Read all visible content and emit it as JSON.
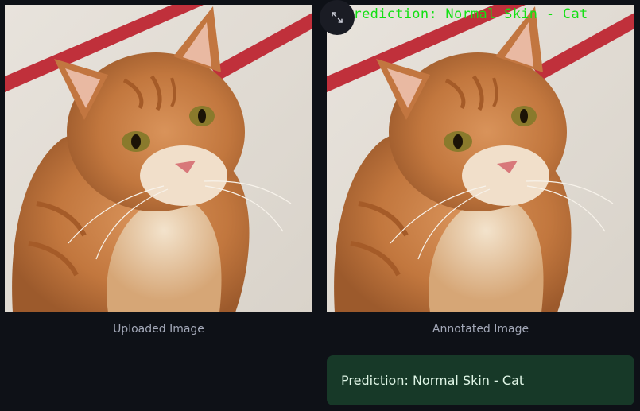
{
  "images": {
    "uploaded": {
      "caption": "Uploaded Image",
      "subject": "orange tabby cat photo"
    },
    "annotated": {
      "caption": "Annotated Image",
      "subject": "orange tabby cat photo",
      "overlay_text": "Prediction: Normal Skin - Cat",
      "overlay_color": "#13e013"
    }
  },
  "toolbar": {
    "fullscreen_icon": "expand-arrows-icon"
  },
  "alert": {
    "text": "Prediction: Normal Skin - Cat",
    "background": "#173928",
    "text_color": "#dff5e6"
  },
  "theme": {
    "background": "#0e1117",
    "caption_color": "#a3a8b8"
  }
}
